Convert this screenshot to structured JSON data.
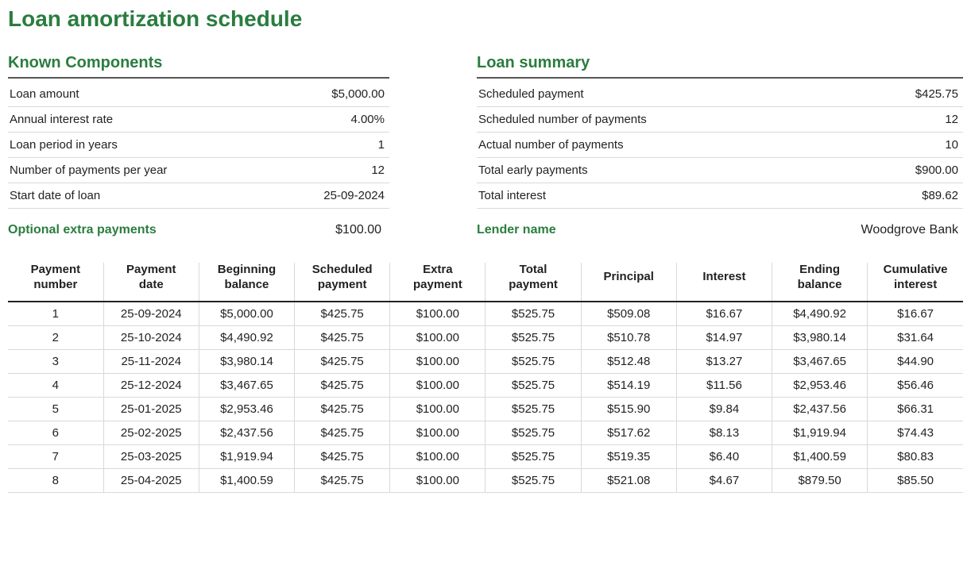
{
  "title": "Loan amortization schedule",
  "known": {
    "heading": "Known Components",
    "rows": [
      {
        "label": "Loan amount",
        "value": "$5,000.00"
      },
      {
        "label": "Annual interest rate",
        "value": "4.00%"
      },
      {
        "label": "Loan period in years",
        "value": "1"
      },
      {
        "label": "Number of payments per year",
        "value": "12"
      },
      {
        "label": "Start date of loan",
        "value": "25-09-2024"
      }
    ],
    "extra_label": "Optional extra payments",
    "extra_value": "$100.00"
  },
  "summary": {
    "heading": "Loan summary",
    "rows": [
      {
        "label": "Scheduled payment",
        "value": "$425.75"
      },
      {
        "label": "Scheduled number of payments",
        "value": "12"
      },
      {
        "label": "Actual number of payments",
        "value": "10"
      },
      {
        "label": "Total early payments",
        "value": "$900.00"
      },
      {
        "label": "Total interest",
        "value": "$89.62"
      }
    ],
    "lender_label": "Lender name",
    "lender_value": "Woodgrove Bank"
  },
  "schedule": {
    "headers": [
      "Payment number",
      "Payment date",
      "Beginning balance",
      "Scheduled payment",
      "Extra payment",
      "Total payment",
      "Principal",
      "Interest",
      "Ending balance",
      "Cumulative interest"
    ],
    "rows": [
      [
        "1",
        "25-09-2024",
        "$5,000.00",
        "$425.75",
        "$100.00",
        "$525.75",
        "$509.08",
        "$16.67",
        "$4,490.92",
        "$16.67"
      ],
      [
        "2",
        "25-10-2024",
        "$4,490.92",
        "$425.75",
        "$100.00",
        "$525.75",
        "$510.78",
        "$14.97",
        "$3,980.14",
        "$31.64"
      ],
      [
        "3",
        "25-11-2024",
        "$3,980.14",
        "$425.75",
        "$100.00",
        "$525.75",
        "$512.48",
        "$13.27",
        "$3,467.65",
        "$44.90"
      ],
      [
        "4",
        "25-12-2024",
        "$3,467.65",
        "$425.75",
        "$100.00",
        "$525.75",
        "$514.19",
        "$11.56",
        "$2,953.46",
        "$56.46"
      ],
      [
        "5",
        "25-01-2025",
        "$2,953.46",
        "$425.75",
        "$100.00",
        "$525.75",
        "$515.90",
        "$9.84",
        "$2,437.56",
        "$66.31"
      ],
      [
        "6",
        "25-02-2025",
        "$2,437.56",
        "$425.75",
        "$100.00",
        "$525.75",
        "$517.62",
        "$8.13",
        "$1,919.94",
        "$74.43"
      ],
      [
        "7",
        "25-03-2025",
        "$1,919.94",
        "$425.75",
        "$100.00",
        "$525.75",
        "$519.35",
        "$6.40",
        "$1,400.59",
        "$80.83"
      ],
      [
        "8",
        "25-04-2025",
        "$1,400.59",
        "$425.75",
        "$100.00",
        "$525.75",
        "$521.08",
        "$4.67",
        "$879.50",
        "$85.50"
      ]
    ]
  }
}
